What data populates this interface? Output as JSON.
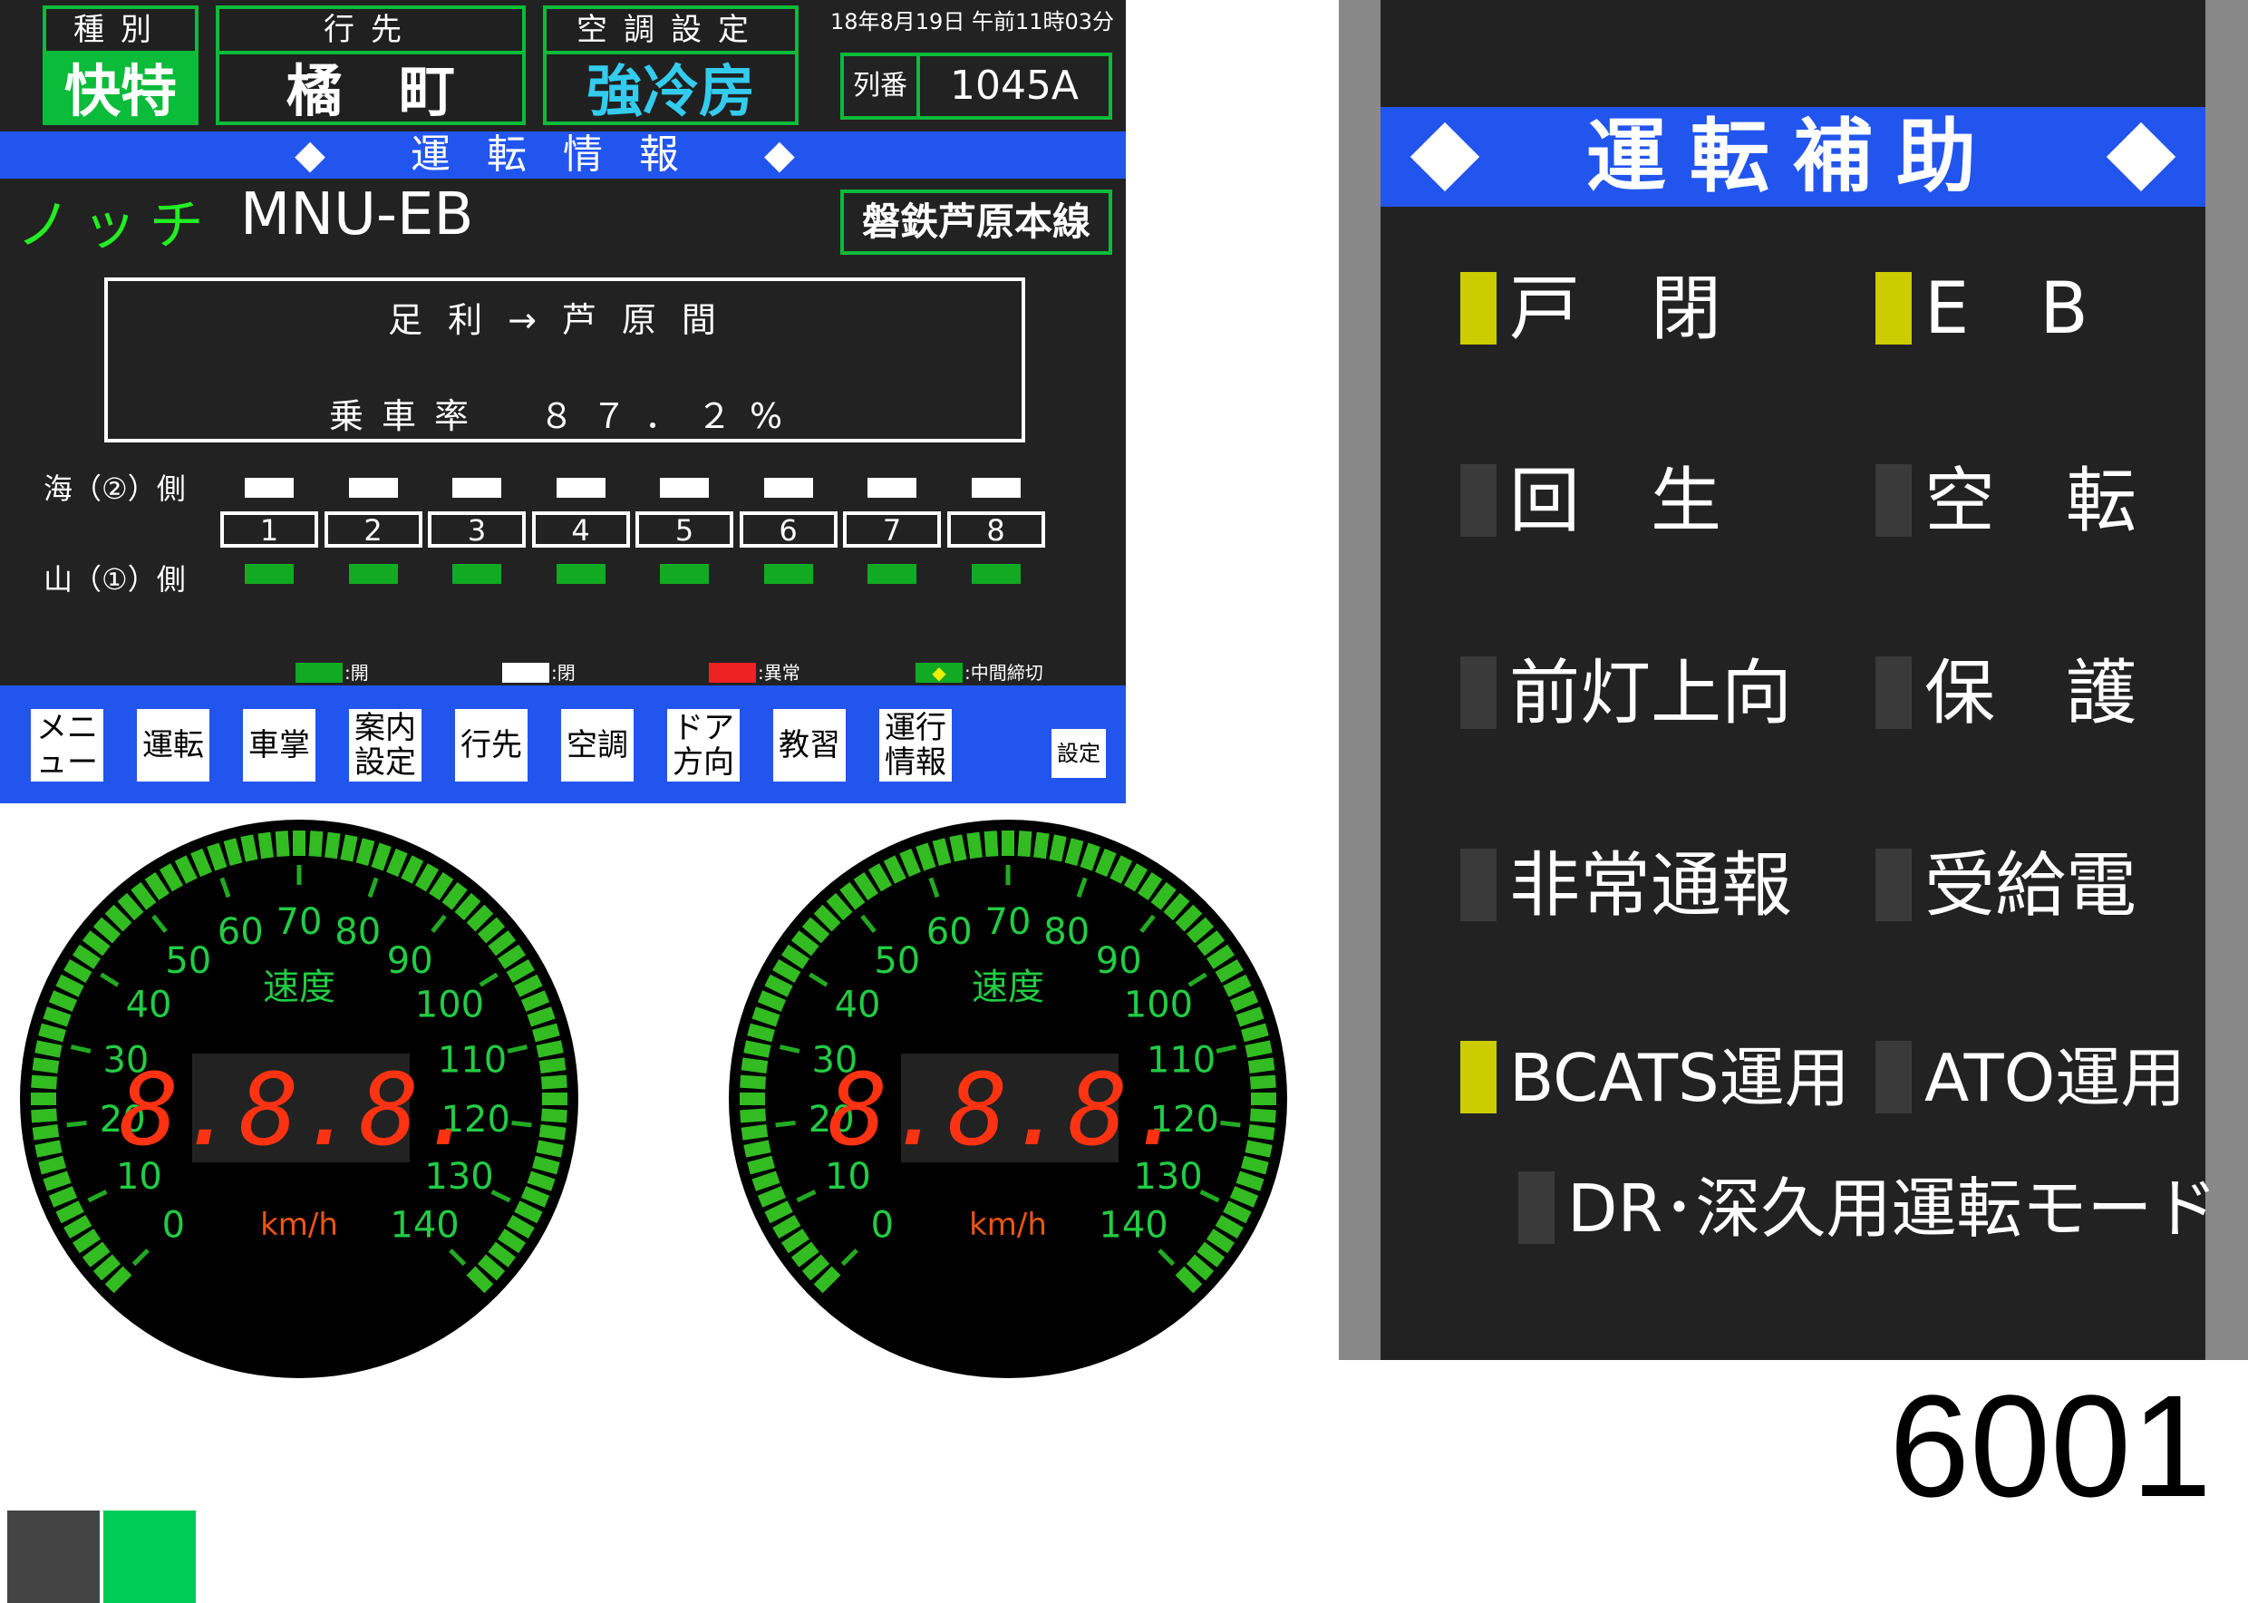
{
  "header": {
    "type_label": "種別",
    "type_value": "快特",
    "dest_label": "行先",
    "dest_value": "橘　町",
    "ac_label": "空調設定",
    "ac_value": "強冷房",
    "datetime": "18年8月19日 午前11時03分",
    "train_no_label": "列番",
    "train_no_value": "1045A"
  },
  "band_title": "◆ 運転情報 ◆",
  "notch": {
    "label": "ノッチ",
    "value": "MNU-EB"
  },
  "line_name": "磐鉄芦原本線",
  "info": {
    "route": "足利→芦原間",
    "rate": "乗車率　８７．２%"
  },
  "sides": {
    "sea": "海（②）側",
    "mountain": "山（①）側"
  },
  "cars": [
    "1",
    "2",
    "3",
    "4",
    "5",
    "6",
    "7",
    "8"
  ],
  "door_state": {
    "sea_color": "#ffffff",
    "mountain_color": "#11aa22"
  },
  "legend": [
    {
      "color": "#11aa22",
      "text": ":開"
    },
    {
      "color": "#ffffff",
      "text": ":閉"
    },
    {
      "color": "#ee2222",
      "text": ":異常"
    },
    {
      "color": "#11aa22",
      "text": ":中間締切",
      "mark": "◆"
    }
  ],
  "menu": [
    "メニュー",
    "運転",
    "車掌",
    "案内設定",
    "行先",
    "空調",
    "ドア方向",
    "教習",
    "運行情報"
  ],
  "settings_label": "設定",
  "gauges": [
    {
      "title": "速度",
      "unit": "km/h",
      "readout": "8.8.8.",
      "ticks": [
        "0",
        "10",
        "20",
        "30",
        "40",
        "50",
        "60",
        "70",
        "80",
        "90",
        "100",
        "110",
        "120",
        "130",
        "140"
      ]
    },
    {
      "title": "速度",
      "unit": "km/h",
      "readout": "8.8.8.",
      "ticks": [
        "0",
        "10",
        "20",
        "30",
        "40",
        "50",
        "60",
        "70",
        "80",
        "90",
        "100",
        "110",
        "120",
        "130",
        "140"
      ]
    }
  ],
  "assist": {
    "title": "運転補助",
    "indicators": [
      {
        "label": "戸　閉",
        "state": "on"
      },
      {
        "label": "E　B",
        "state": "on"
      },
      {
        "label": "回　生",
        "state": "off"
      },
      {
        "label": "空　転",
        "state": "off"
      },
      {
        "label": "前灯上向",
        "state": "off"
      },
      {
        "label": "保　護",
        "state": "off"
      },
      {
        "label": "非常通報",
        "state": "off"
      },
      {
        "label": "受給電",
        "state": "off"
      },
      {
        "label": "BCATS運用",
        "state": "on"
      },
      {
        "label": "ATO運用",
        "state": "off"
      },
      {
        "label": "DR･深久用運転モード",
        "state": "off"
      }
    ],
    "on_color": "#cccc00",
    "off_color": "#3a3a3a"
  },
  "unit_number": "6001",
  "colors": {
    "accent_blue": "#2255ee",
    "frame_green": "#0bbb3a",
    "panel": "#222222",
    "swatch_dark": "#444444",
    "swatch_green": "#00cc55"
  }
}
